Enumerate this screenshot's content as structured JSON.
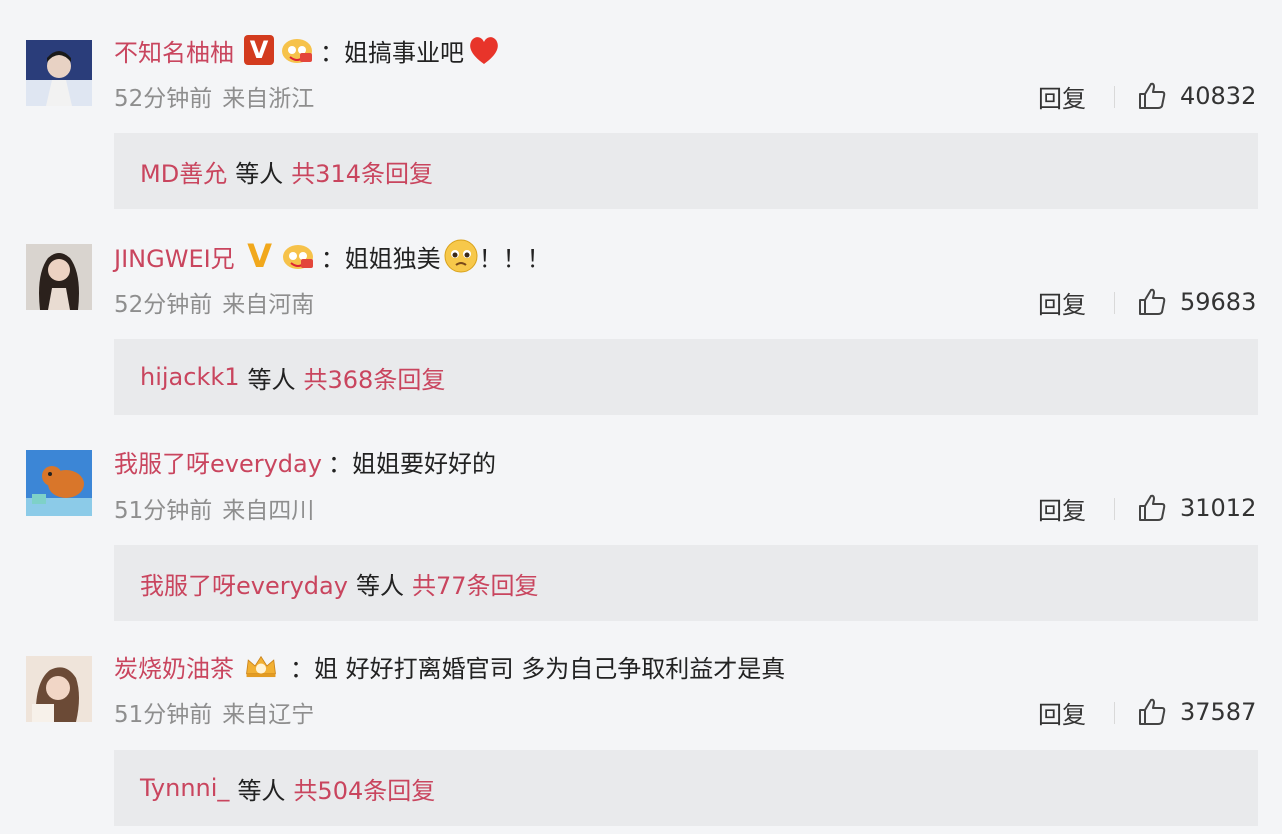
{
  "comments": [
    {
      "username": "不知名柚柚",
      "verify": "V",
      "text": "姐搞事业吧",
      "emoji": "heart-icon",
      "time": "52分钟前",
      "location": "来自浙江",
      "reply_label": "回复",
      "likes": "40832",
      "reply_user": "MD善允",
      "reply_mid": "等人",
      "reply_count": "共314条回复"
    },
    {
      "username": "JINGWEI兄",
      "verify": "V",
      "text": "姐姐独美",
      "suffix": "！！！",
      "emoji": "pleading-face-icon",
      "time": "52分钟前",
      "location": "来自河南",
      "reply_label": "回复",
      "likes": "59683",
      "reply_user": "hijackk1",
      "reply_mid": "等人",
      "reply_count": "共368条回复"
    },
    {
      "username": "我服了呀everyday",
      "text": "姐姐要好好的",
      "time": "51分钟前",
      "location": "来自四川",
      "reply_label": "回复",
      "likes": "31012",
      "reply_user": "我服了呀everyday",
      "reply_mid": "等人",
      "reply_count": "共77条回复"
    },
    {
      "username": "炭烧奶油茶",
      "text": "姐 好好打离婚官司 多为自己争取利益才是真",
      "time": "51分钟前",
      "location": "来自辽宁",
      "reply_label": "回复",
      "likes": "37587",
      "reply_user": "Tynnni_",
      "reply_mid": "等人",
      "reply_count": "共504条回复"
    }
  ],
  "colors": {
    "username": "#c9455e",
    "background": "#f4f5f7",
    "reply_box": "#e9eaec",
    "meta": "#8e8e8e"
  }
}
